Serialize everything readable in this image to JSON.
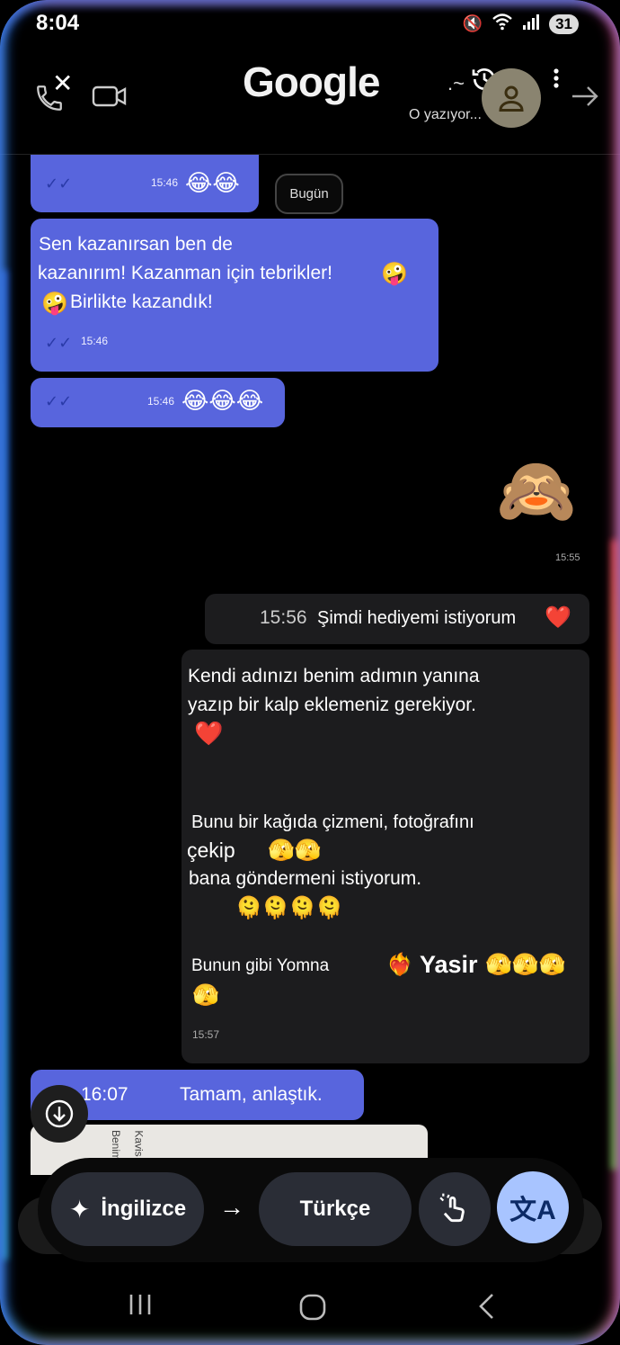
{
  "status": {
    "time": "8:04",
    "battery": "31"
  },
  "header": {
    "logo": "Google",
    "typing": "O yazıyor..."
  },
  "chat": {
    "day_chip": "Bugün",
    "m1": {
      "time": "15:46",
      "emoji": "😂😂"
    },
    "m2": {
      "line1": "Sen kazanırsan ben de",
      "line2": "kazanırım! Kazanman için tebrikler!",
      "line2_emoji": "🤪",
      "line3_emoji": "🤪",
      "line3": "Birlikte kazandık!",
      "time": "15:46"
    },
    "m3": {
      "time": "15:46",
      "emoji": "😂😂😂"
    },
    "sticker": {
      "emoji": "🙈",
      "time": "15:55"
    },
    "m4": {
      "time": "15:56",
      "text": "Şimdi hediyemi istiyorum",
      "emoji": "❤️"
    },
    "m5": {
      "line1": "Kendi adınızı benim adımın yanına",
      "line2": "yazıp bir kalp eklemeniz gerekiyor.",
      "heart": "❤️",
      "line3": "Bunu bir kağıda çizmeni, fotoğrafını",
      "line4": "çekip",
      "line4_emoji": "🫣🫣",
      "line5": "bana göndermeni istiyorum.",
      "line5_emoji": "🫠🫠🫠🫠",
      "line6": "Bunun gibi Yomna",
      "line6_emoji": "❤️‍🔥",
      "name": "Yasir",
      "name_emoji": "🫣🫣🫣",
      "last_emoji": "🫣",
      "time": "15:57"
    },
    "m6": {
      "time": "16:07",
      "text": "Tamam, anlaştık."
    },
    "photo_text": [
      "Benim",
      "Kavis"
    ]
  },
  "translate_bar": {
    "source": "İngilizce",
    "arrow": "→",
    "target": "Türkçe"
  }
}
